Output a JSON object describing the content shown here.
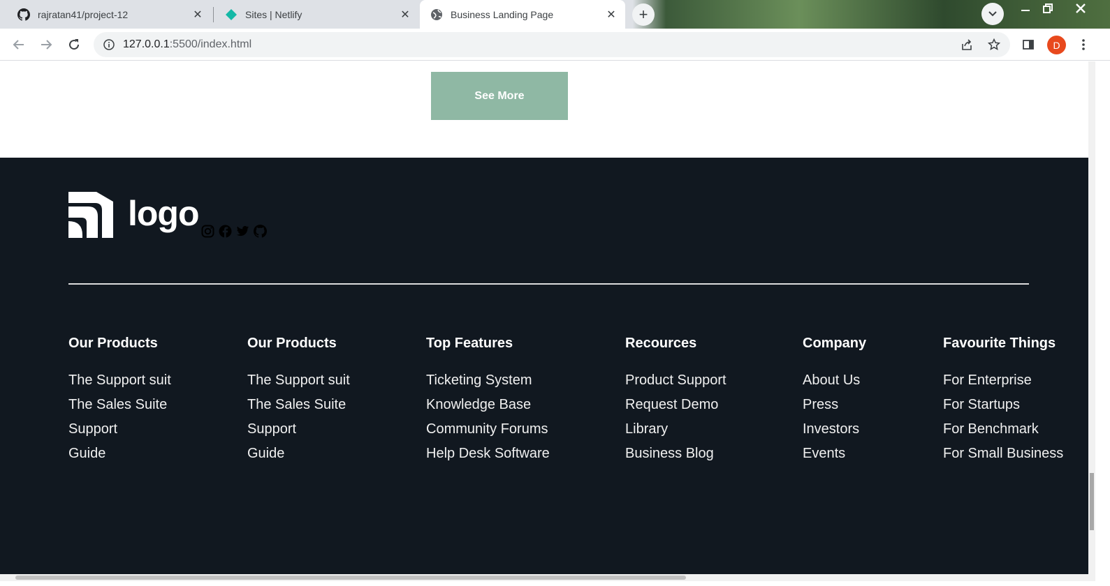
{
  "browser": {
    "tabs": [
      {
        "title": "rajratan41/project-12",
        "icon": "github-icon",
        "active": false
      },
      {
        "title": "Sites | Netlify",
        "icon": "netlify-icon",
        "active": false
      },
      {
        "title": "Business Landing Page",
        "icon": "globe-icon",
        "active": true
      }
    ],
    "url_host": "127.0.0.1",
    "url_rest": ":5500/index.html",
    "avatar_letter": "D",
    "avatar_color": "#e8491d"
  },
  "page": {
    "see_more_label": "See More",
    "see_more_color": "#8fb8a4",
    "footer_bg": "#111820",
    "logo_text": "logo",
    "socials": [
      "instagram-icon",
      "facebook-icon",
      "twitter-icon",
      "github-icon"
    ],
    "columns": [
      {
        "heading": "Our Products",
        "links": [
          "The Support suit",
          "The Sales Suite",
          "Support",
          "Guide"
        ]
      },
      {
        "heading": "Our Products",
        "links": [
          "The Support suit",
          "The Sales Suite",
          "Support",
          "Guide"
        ]
      },
      {
        "heading": "Top Features",
        "links": [
          "Ticketing System",
          "Knowledge Base",
          "Community Forums",
          "Help Desk Software"
        ]
      },
      {
        "heading": "Recources",
        "links": [
          "Product Support",
          "Request Demo",
          "Library",
          "Business Blog"
        ]
      },
      {
        "heading": "Company",
        "links": [
          "About Us",
          "Press",
          "Investors",
          "Events"
        ]
      },
      {
        "heading": "Favourite Things",
        "links": [
          "For Enterprise",
          "For Startups",
          "For Benchmark",
          "For Small Business"
        ]
      }
    ]
  }
}
